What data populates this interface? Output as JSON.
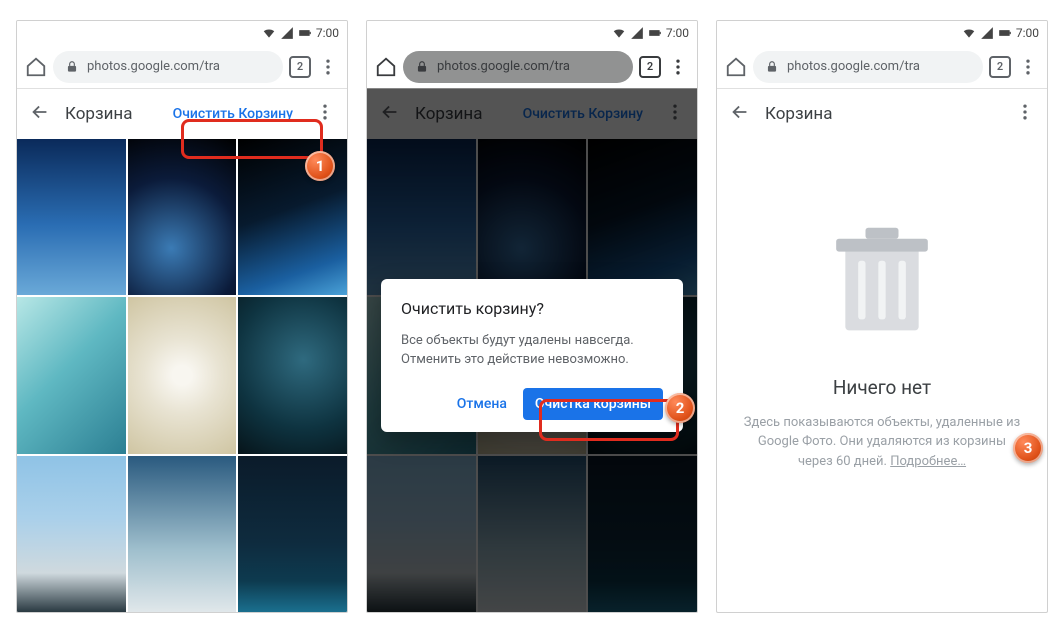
{
  "status": {
    "time": "7:00"
  },
  "url": {
    "text": "photos.google.com/tra",
    "tab_count": "2"
  },
  "appbar": {
    "title": "Корзина",
    "empty_trash": "Очистить Корзину"
  },
  "dialog": {
    "title": "Очистить корзину?",
    "body": "Все объекты будут удалены навсегда. Отменить это действие невозможно.",
    "cancel": "Отмена",
    "confirm": "Очистка корзины"
  },
  "empty": {
    "title": "Ничего нет",
    "body": "Здесь показываются объекты, удаленные из Google Фото. Они удаляются из корзины через 60 дней.",
    "more": "Подробнее…"
  },
  "badge": {
    "one": "1",
    "two": "2",
    "three": "3"
  }
}
